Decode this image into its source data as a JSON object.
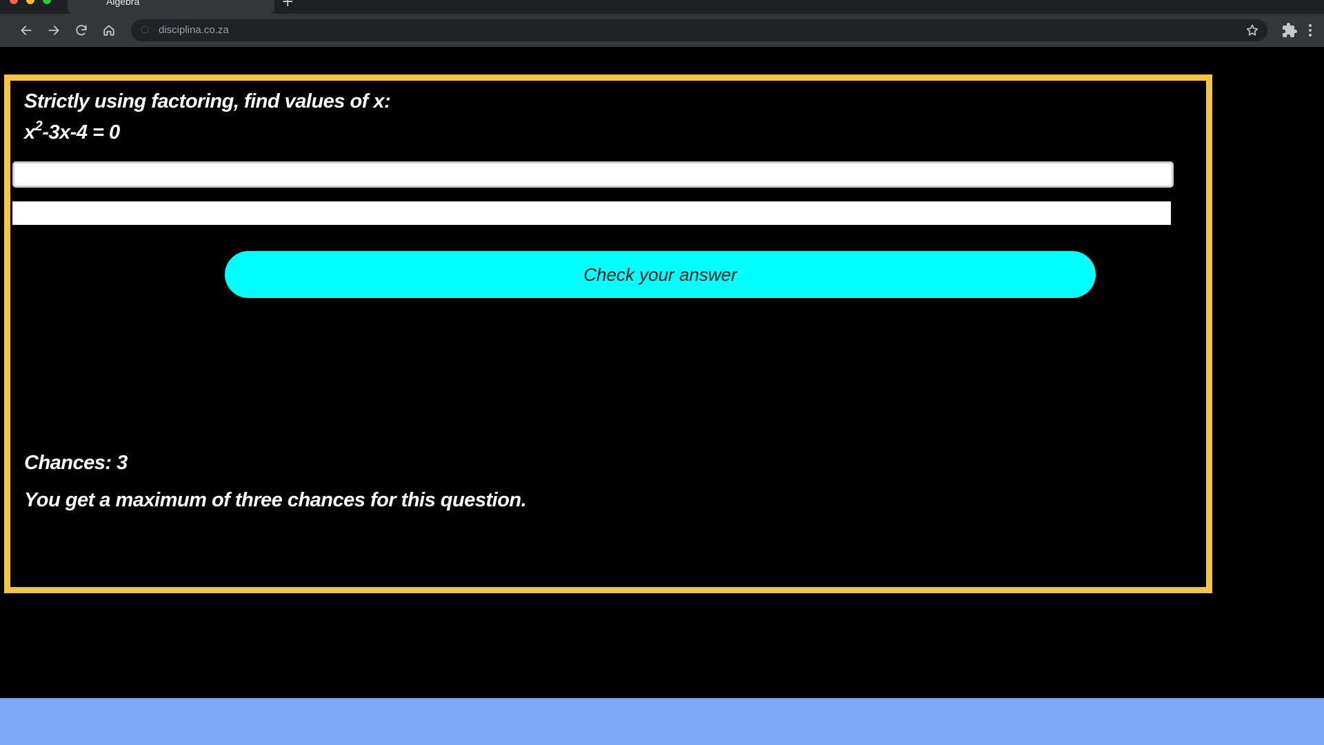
{
  "browser": {
    "tab_title": "Algebra",
    "new_tab_glyph": "+",
    "url": "disciplina.co.za",
    "icons": [
      "back-icon",
      "forward-icon",
      "reload-icon",
      "home-icon",
      "star-icon",
      "extensions-icon",
      "menu-icon"
    ]
  },
  "quiz": {
    "question": "Strictly using factoring, find values of x:",
    "equation_base": "x",
    "equation_exponent": "2",
    "equation_rest": "-3x-4 = 0",
    "answer_1_value": "",
    "answer_2_value": "",
    "check_label": "Check your answer",
    "chances_text": "Chances: 3",
    "notice_text": "You get a maximum of three chances for this question."
  },
  "colors": {
    "highlight_border": "#f5c542",
    "button": "#00ffff",
    "page_background": "#000000",
    "desktop_background": "#7aa8f2"
  }
}
